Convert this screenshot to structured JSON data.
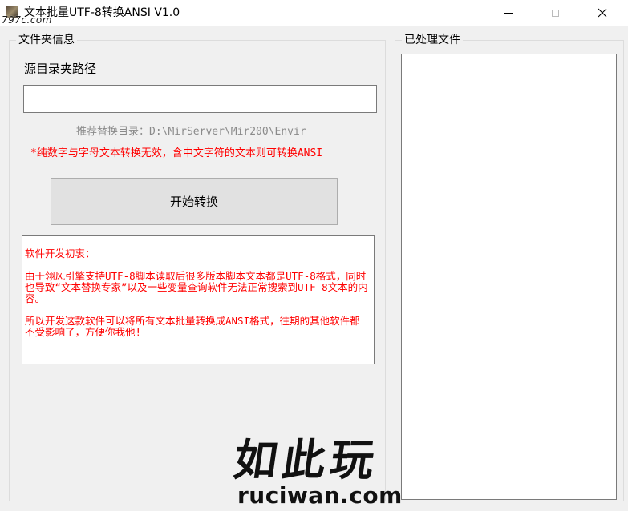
{
  "window": {
    "title": "文本批量UTF-8转换ANSI  V1.0",
    "controls": {
      "minimize_icon": "minimize-icon",
      "maximize_icon": "maximize-icon",
      "close_icon": "close-icon",
      "close_glyph": "✕"
    }
  },
  "watermark_top": "797c.com",
  "folder_group": {
    "title": "文件夹信息",
    "source_label": "源目录夹路径",
    "path_value": "",
    "path_placeholder": "",
    "hint_dir": "推荐替换目录：D:\\MirServer\\Mir200\\Envir",
    "hint_note": "*纯数字与字母文本转换无效，含中文字符的文本则可转换ANSI",
    "start_button": "开始转换",
    "info": {
      "heading": "软件开发初衷：",
      "para1": "由于翎风引擎支持UTF-8脚本读取后很多版本脚本文本都是UTF-8格式，同时也导致“文本替换专家”以及一些变量查询软件无法正常搜索到UTF-8文本的内容。",
      "para2": "所以开发这款软件可以将所有文本批量转换成ANSI格式，往期的其他软件都不受影响了，方便你我他!"
    }
  },
  "processed_group": {
    "title": "已处理文件"
  },
  "watermark_bottom": {
    "logo": "如此玩",
    "url": "ruciwan.com"
  },
  "colors": {
    "background": "#f0f0f0",
    "warning_red": "#ff0000",
    "hint_gray": "#8a8a8a"
  }
}
